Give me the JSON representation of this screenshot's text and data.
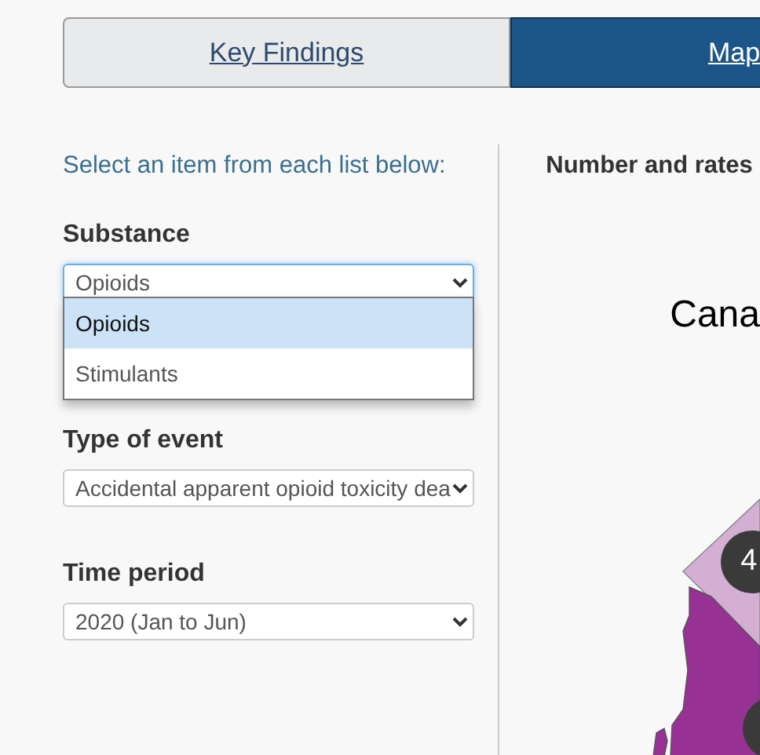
{
  "tabs": [
    {
      "label": "Key Findings",
      "selected": false
    },
    {
      "label": "Map",
      "selected": true
    }
  ],
  "instructions": "Select an item from each list below:",
  "filters": [
    {
      "label": "Substance",
      "value": "Opioids",
      "expanded": true,
      "options": [
        {
          "label": "Opioids",
          "selected": true
        },
        {
          "label": "Stimulants",
          "selected": false
        }
      ]
    },
    {
      "label": "Type of event",
      "value": "Accidental apparent opioid toxicity dea",
      "expanded": false
    },
    {
      "label": "Time period",
      "value": "2020 (Jan to Jun)",
      "expanded": false
    }
  ],
  "map_panel": {
    "heading": "Number and rates",
    "map_title": "Cana",
    "markers": [
      "4"
    ]
  }
}
